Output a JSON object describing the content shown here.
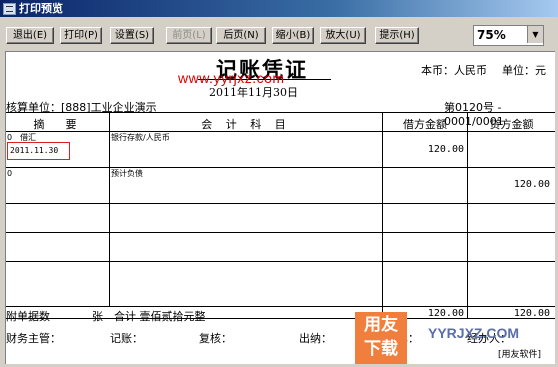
{
  "window": {
    "title": "打印预览"
  },
  "toolbar": {
    "buttons": [
      "退出(E)",
      "打印(P)",
      "设置(S)",
      "前页(L)",
      "后页(N)",
      "缩小(B)",
      "放大(U)",
      "提示(H)"
    ],
    "zoom": "75%"
  },
  "voucher": {
    "title": "记账凭证",
    "date": "2011年11月30日",
    "currency": "本币：人民币",
    "unit": "单位：元",
    "org": "核算单位：[888]工业企业演示",
    "number": "第0120号 - 0001/0001",
    "headers": {
      "summary": "摘　要",
      "account": "会 计 科 目",
      "debit": "借方金额",
      "credit": "贷方金额"
    },
    "rows": [
      {
        "summary": "0　借汇",
        "date_stamp": "2011.11.30",
        "account": "银行存款/人民币",
        "debit": "120.00",
        "credit": ""
      },
      {
        "summary": "0",
        "account": "预计负债",
        "debit": "",
        "credit": "120.00"
      }
    ],
    "footer": {
      "attach_label": "附单据数",
      "attach_unit": "张",
      "total_label": "合计 壹佰贰拾元整",
      "debit_total": "120.00",
      "credit_total": "120.00"
    },
    "signatures": {
      "supervisor": "财务主管：",
      "bookkeeper": "记账：",
      "reviewer": "复核：",
      "cashier": "出纳：",
      "preparer": "制单：",
      "handler": "经办人："
    }
  },
  "watermarks": {
    "url": "www.yyrjxz.com",
    "logo_line1": "用友",
    "logo_line2": "下载",
    "site": "YYRJXZ.COM",
    "site_sub": "[用友软件]"
  }
}
